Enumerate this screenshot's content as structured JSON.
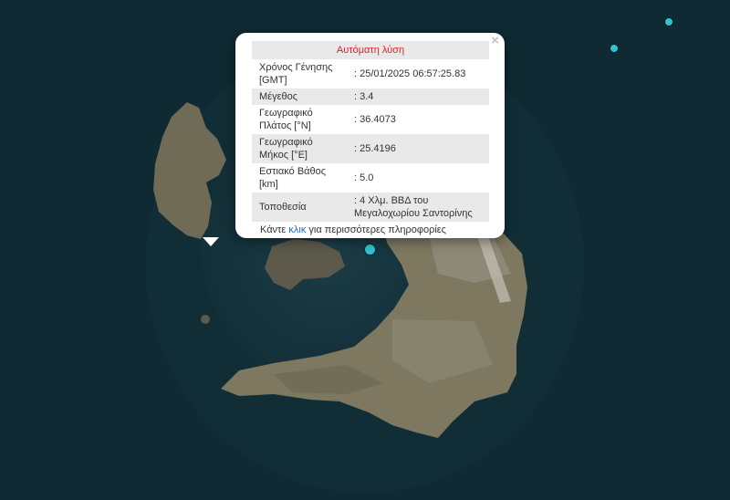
{
  "map": {
    "colors": {
      "sea": "#0f2a33",
      "caldera_water": "#17363f",
      "land": "#7a7560",
      "marker": "#33c3cf"
    },
    "markers": [
      {
        "name": "selected-earthquake-marker",
        "selected": true
      },
      {
        "name": "earthquake-marker-2",
        "selected": false
      },
      {
        "name": "earthquake-marker-3",
        "selected": false
      }
    ]
  },
  "popup": {
    "title": "Αυτόματη λύση",
    "close_symbol": "×",
    "rows": [
      {
        "label": "Χρόνος Γένησης [GMT]",
        "value": ": 25/01/2025 06:57:25.83"
      },
      {
        "label": "Μέγεθος",
        "value": ": 3.4"
      },
      {
        "label": "Γεωγραφικό Πλάτος [°N]",
        "value": ": 36.4073"
      },
      {
        "label": "Γεωγραφικό Μήκος [°E]",
        "value": ": 25.4196"
      },
      {
        "label": "Εστιακό Βάθος [km]",
        "value": ": 5.0"
      },
      {
        "label": "Τοποθεσία",
        "value": ": 4 Χλμ. ΒΒΔ του Μεγαλοχωρίου Σαντορίνης"
      }
    ],
    "footer_prefix": "Κάντε ",
    "footer_link": "κλικ",
    "footer_suffix": " για περισσότερες πληροφορίες"
  }
}
